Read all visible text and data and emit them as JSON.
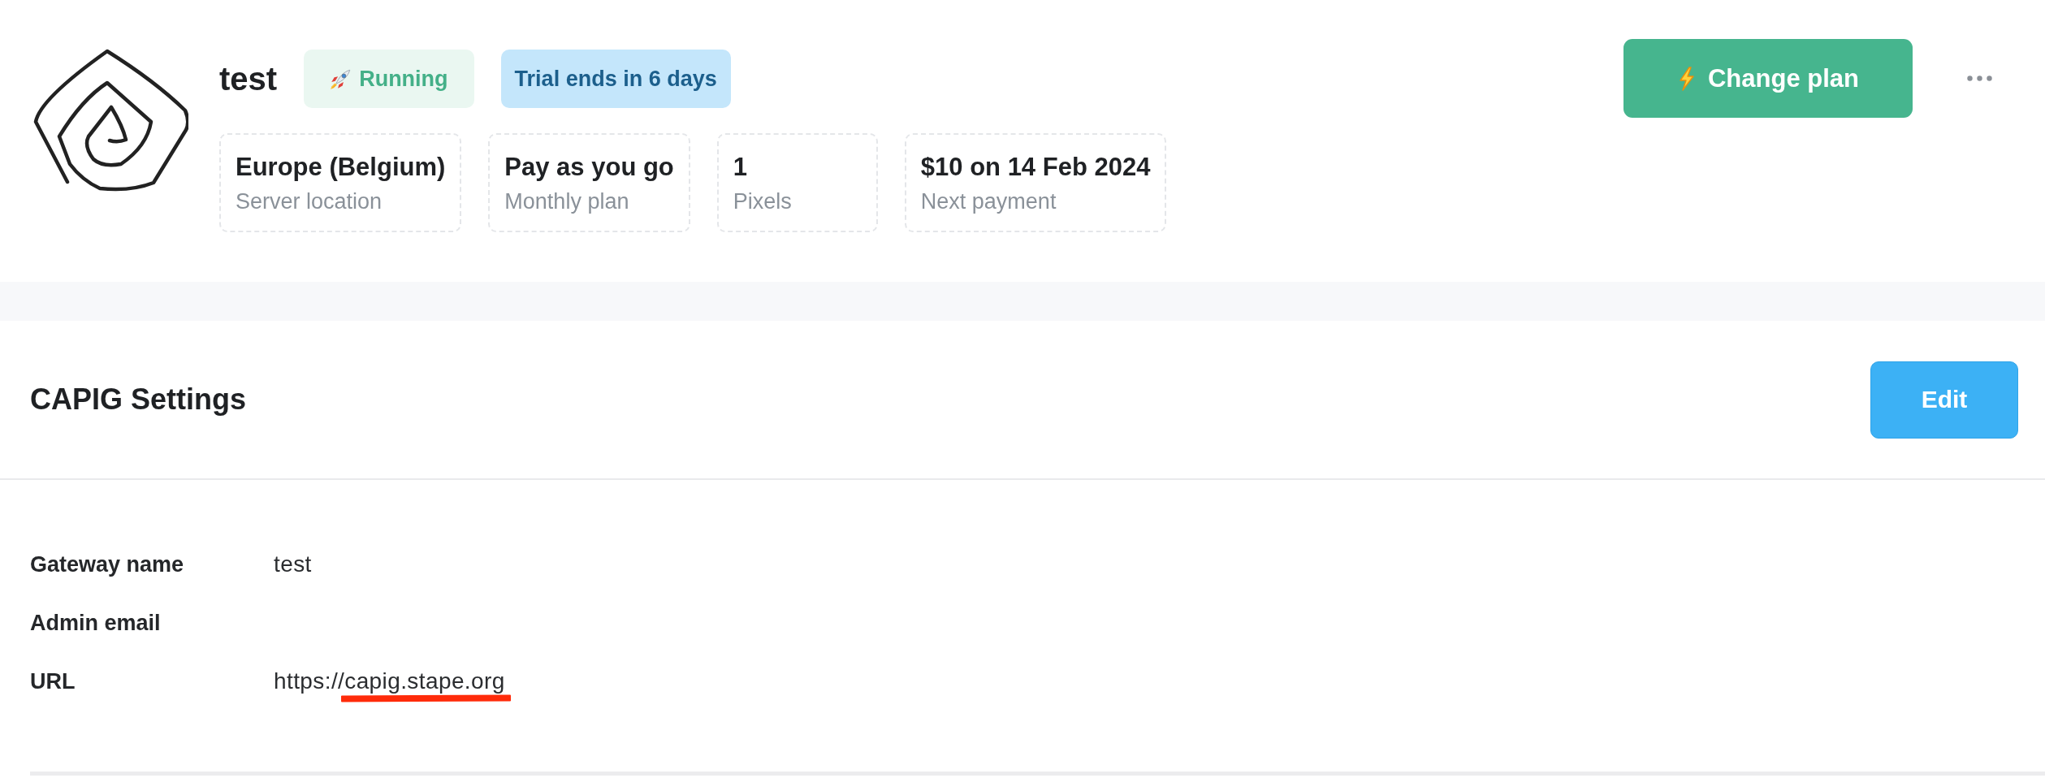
{
  "header": {
    "title": "test",
    "badges": [
      {
        "kind": "status",
        "label": "Running"
      },
      {
        "kind": "trial",
        "label": "Trial ends in 6 days"
      }
    ],
    "stats": [
      {
        "value": "Europe (Belgium)",
        "label": "Server location"
      },
      {
        "value": "Pay as you go",
        "label": "Monthly plan"
      },
      {
        "value": "1",
        "label": "Pixels"
      },
      {
        "value": "$10 on 14 Feb 2024",
        "label": "Next payment"
      }
    ],
    "primary_button": {
      "label": "Change plan"
    }
  },
  "settings": {
    "title": "CAPIG Settings",
    "edit_button": {
      "label": "Edit"
    },
    "rows": [
      {
        "label": "Gateway name",
        "value": "test"
      },
      {
        "label": "Admin email"
      },
      {
        "label": "URL",
        "value_parts": [
          {
            "text": "https://",
            "underlined": false
          },
          {
            "text": "capig.stape.org",
            "underlined": true
          }
        ]
      }
    ]
  }
}
